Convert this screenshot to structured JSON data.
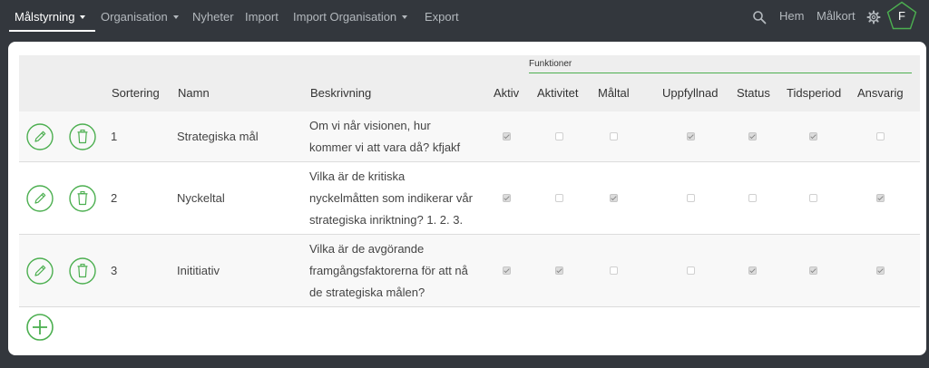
{
  "nav": {
    "items": [
      {
        "label": "Målstyrning",
        "active": true,
        "dropdown": true
      },
      {
        "label": "Organisation",
        "active": false,
        "dropdown": true
      },
      {
        "label": "Nyheter",
        "active": false,
        "dropdown": false
      },
      {
        "label": "Import",
        "active": false,
        "dropdown": false
      },
      {
        "label": "Import Organisation",
        "active": false,
        "dropdown": true
      },
      {
        "label": "Export",
        "active": false,
        "dropdown": false
      }
    ],
    "right": {
      "search_icon": "search-icon",
      "home_label": "Hem",
      "malkort_label": "Målkort",
      "settings_icon": "gear-icon",
      "avatar_letter": "F"
    }
  },
  "table": {
    "group_header": "Funktioner",
    "columns": {
      "sortering": "Sortering",
      "namn": "Namn",
      "beskrivning": "Beskrivning",
      "aktiv": "Aktiv",
      "aktivitet": "Aktivitet",
      "maltal": "Måltal",
      "uppfyllnad": "Uppfyllnad",
      "status": "Status",
      "tidsperiod": "Tidsperiod",
      "ansvarig": "Ansvarig"
    },
    "rows": [
      {
        "sort": "1",
        "name": "Strategiska mål",
        "desc_lines": [
          "Om vi når visionen, hur",
          "kommer vi att vara då? kfjakf"
        ],
        "checks": [
          true,
          false,
          false,
          true,
          true,
          true,
          false
        ]
      },
      {
        "sort": "2",
        "name": "Nyckeltal",
        "desc_lines": [
          "Vilka är de kritiska",
          "nyckelmåtten som indikerar vår",
          "strategiska inriktning? 1. 2. 3."
        ],
        "checks": [
          true,
          false,
          true,
          false,
          false,
          false,
          true
        ]
      },
      {
        "sort": "3",
        "name": "Inititiativ",
        "desc_lines": [
          "Vilka är de avgörande",
          "framgångsfaktorerna för att nå",
          "de strategiska målen?"
        ],
        "checks": [
          true,
          true,
          false,
          false,
          true,
          true,
          true
        ]
      }
    ]
  },
  "icons": {
    "edit": "pencil-icon",
    "delete": "trash-icon",
    "add": "plus-icon"
  },
  "colors": {
    "accent": "#4caf50",
    "nav_bg": "#33373d",
    "header_bg": "#eeeeee"
  }
}
